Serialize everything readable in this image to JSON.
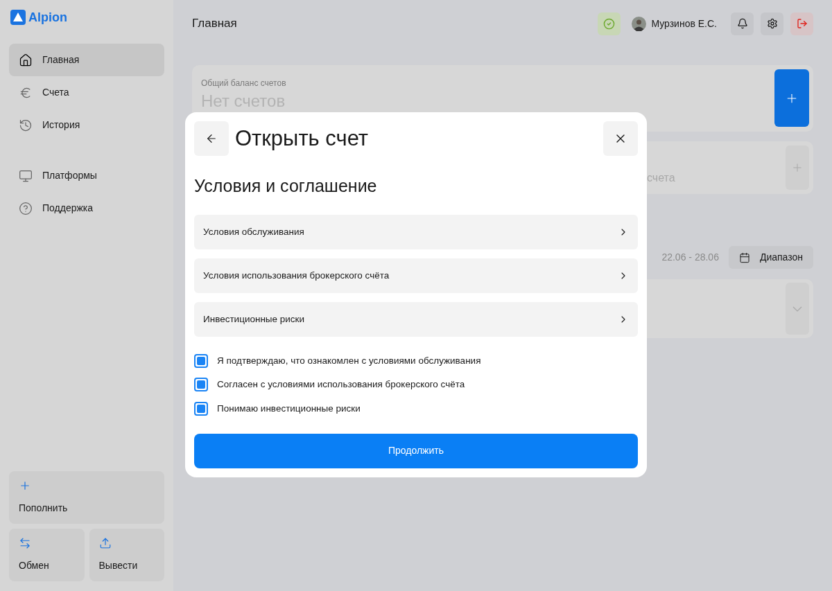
{
  "logo": {
    "text": "Alpion"
  },
  "sidebar": {
    "items": [
      {
        "label": "Главная",
        "selected": true
      },
      {
        "label": "Счета",
        "selected": false
      },
      {
        "label": "История",
        "selected": false
      },
      {
        "label": "Платформы",
        "selected": false
      },
      {
        "label": "Поддержка",
        "selected": false
      }
    ],
    "actions": [
      {
        "label": "Пополнить"
      },
      {
        "label": "Обмен"
      },
      {
        "label": "Вывести"
      }
    ]
  },
  "header": {
    "title": "Главная",
    "user": "Мурзинов Е.С."
  },
  "balance_card": {
    "label": "Общий баланс счетов",
    "value": "Нет счетов"
  },
  "accounts_card": {
    "text": "счета"
  },
  "range": {
    "dates": "22.06 - 28.06",
    "button": "Диапазон"
  },
  "modal": {
    "title": "Открыть счет",
    "section": "Условия и соглашение",
    "links": [
      {
        "label": "Условия обслуживания"
      },
      {
        "label": "Условия использования брокерского счёта"
      },
      {
        "label": "Инвестиционные риски"
      }
    ],
    "checkboxes": [
      {
        "label": "Я подтверждаю, что ознакомлен с условиями обслуживания",
        "checked": true
      },
      {
        "label": "Согласен с условиями использования брокерского счёта",
        "checked": true
      },
      {
        "label": "Понимаю инвестиционные риски",
        "checked": true
      }
    ],
    "submit": "Продолжить"
  }
}
